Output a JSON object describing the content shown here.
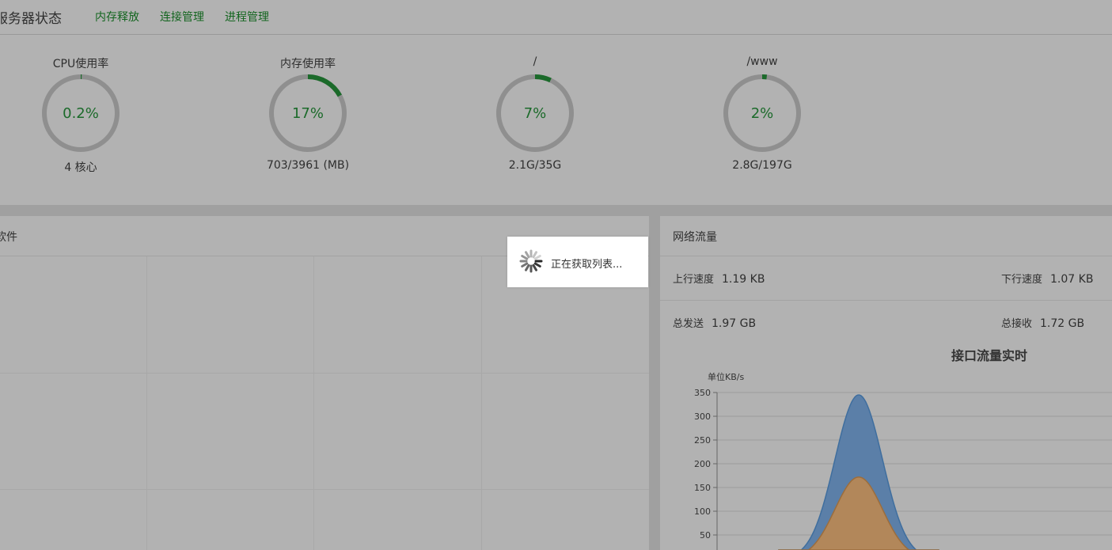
{
  "header": {
    "title": "服务器状态",
    "links": [
      "内存释放",
      "连接管理",
      "进程管理"
    ]
  },
  "gauges": [
    {
      "label": "CPU使用率",
      "value": "0.2%",
      "sub": "4 核心",
      "percent": 0.2
    },
    {
      "label": "内存使用率",
      "value": "17%",
      "sub": "703/3961 (MB)",
      "percent": 17
    },
    {
      "label": "/",
      "value": "7%",
      "sub": "2.1G/35G",
      "percent": 7
    },
    {
      "label": "/www",
      "value": "2%",
      "sub": "2.8G/197G",
      "percent": 2
    }
  ],
  "files_panel": {
    "title": "软件"
  },
  "loading": {
    "text": "正在获取列表..."
  },
  "network": {
    "title": "网络流量",
    "upload_speed_label": "上行速度",
    "upload_speed": "1.19 KB",
    "download_speed_label": "下行速度",
    "download_speed": "1.07 KB",
    "total_sent_label": "总发送",
    "total_sent": "1.97 GB",
    "total_received_label": "总接收",
    "total_received": "1.72 GB"
  },
  "colors": {
    "accent_green": "#13651f",
    "upload_area": "#5b7fa8",
    "download_area": "#b2875a"
  },
  "chart_data": {
    "type": "area",
    "title": "接口流量实时",
    "ylabel": "单位KB/s",
    "ylim": [
      0,
      350
    ],
    "yticks": [
      50,
      100,
      150,
      200,
      250,
      300,
      350
    ],
    "grid": true,
    "series": [
      {
        "peak": 345,
        "color": "#5b7fa8"
      },
      {
        "peak": 172,
        "color": "#b2875a"
      }
    ]
  }
}
